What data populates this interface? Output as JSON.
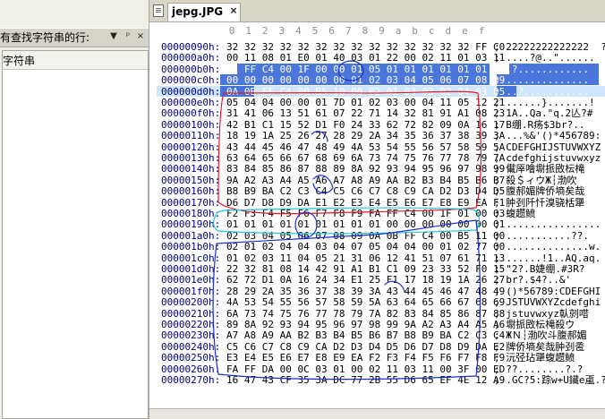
{
  "left_panel": {
    "title": "有查找字符串的行:",
    "pin_button": "▼",
    "dock_button": "ᵖ",
    "close_button": "×",
    "list_item": "字符串"
  },
  "tab": {
    "label": "jepg.JPG",
    "close_label": "×"
  },
  "hex": {
    "column_labels": [
      "0",
      "1",
      "2",
      "3",
      "4",
      "5",
      "6",
      "7",
      "8",
      "9",
      "a",
      "b",
      "c",
      "d",
      "e",
      "f"
    ],
    "rows": [
      {
        "addr": "00000090h:",
        "bytes": "32 32 32 32 32 32 32 32 32 32 32 32 32 32 FF C0",
        "ascii": "; 22222222222222  ?"
      },
      {
        "addr": "000000a0h:",
        "bytes": "00 11 08 01 E0 01 40 03 01 22 00 02 11 01 03 11",
        "ascii": "; ....?@..\"......"
      },
      {
        "addr": "000000b0h:",
        "bytes": "01 FF C4 00 1F 00 00 01 05 01 01 01 01 01 01 00",
        "ascii": "; .?............"
      },
      {
        "addr": "000000c0h:",
        "bytes": "00 00 00 00 00 00 00 01 02 03 04 05 06 07 08 09",
        "ascii": "; .............."
      },
      {
        "addr": "000000d0h:",
        "bytes": "0A 0B FF C4 00 B5 10 00 02 01 03 03 02 04 03 05",
        "ascii": "; ..?..........."
      },
      {
        "addr": "000000e0h:",
        "bytes": "05 04 04 00 00 01 7D 01 02 03 00 04 11 05 12 21",
        "ascii": "; ......}.......!"
      },
      {
        "addr": "000000f0h:",
        "bytes": "31 41 06 13 51 61 07 22 71 14 32 81 91 A1 08 23",
        "ascii": "; 1A..Qa.\"q.2亾?#"
      },
      {
        "addr": "00000100h:",
        "bytes": "42 B1 C1 15 52 D1 F0 24 33 62 72 82 09 0A 16 17",
        "ascii": "; B绷.R疡$3br?.."
      },
      {
        "addr": "00000110h:",
        "bytes": "18 19 1A 25 26 27 28 29 2A 34 35 36 37 38 39 3A",
        "ascii": "; ...%&'()*456789:"
      },
      {
        "addr": "00000120h:",
        "bytes": "43 44 45 46 47 48 49 4A 53 54 55 56 57 58 59 5A",
        "ascii": "; CDEFGHIJSTUVWXYZ"
      },
      {
        "addr": "00000130h:",
        "bytes": "63 64 65 66 67 68 69 6A 73 74 75 76 77 78 79 7A",
        "ascii": "; cdefghijstuvwxyz"
      },
      {
        "addr": "00000140h:",
        "bytes": "83 84 85 86 87 88 89 8A 92 93 94 95 96 97 98 99",
        "ascii": "; 儎厗噲墛挀敃枟槞"
      },
      {
        "addr": "00000150h:",
        "bytes": "9A A2 A3 A4 A5 A6 A7 A8 A9 AA B2 B3 B4 B5 B6 B7",
        "ascii": "; 殺＄ィウЖ┆渤吹"
      },
      {
        "addr": "00000160h:",
        "bytes": "B8 B9 BA C2 C3 C4 C5 C6 C7 C8 C9 CA D2 D3 D4 D5",
        "ascii": "; 腹郝媚牌侨墒矣哉"
      },
      {
        "addr": "00000170h:",
        "bytes": "D6 D7 D8 D9 DA E1 E2 E3 E4 E5 E6 E7 E8 E9 EA F1",
        "ascii": "; 肿刭阡忏溴骁栝犟"
      },
      {
        "addr": "00000180h:",
        "bytes": "F2 F3 F4 F5 F6 F7 F8 F9 FA FF C4 00 1F 01 00 03",
        "ascii": "; 蝮趱鲼"
      },
      {
        "addr": "00000190h:",
        "bytes": "01 01 01 01 01 01 01 01 01 00 00 00 00 00 00 01",
        "ascii": "; ................"
      },
      {
        "addr": "000001a0h:",
        "bytes": "02 03 04 05 06 07 08 09 0A 0B FF C4 00 B5 11 00",
        "ascii": "; ...........??."
      },
      {
        "addr": "000001b0h:",
        "bytes": "02 01 02 04 04 03 04 07 05 04 04 00 01 02 77 00",
        "ascii": "; ..............w."
      },
      {
        "addr": "000001c0h:",
        "bytes": "01 02 03 11 04 05 21 31 06 12 41 51 07 61 71 13",
        "ascii": "; ......!1..AQ.aq."
      },
      {
        "addr": "000001d0h:",
        "bytes": "22 32 81 08 14 42 91 A1 B1 C1 09 23 33 52 F0 15",
        "ascii": "; \"2?.B婕绷.#3R?"
      },
      {
        "addr": "000001e0h:",
        "bytes": "62 72 D1 0A 16 24 34 E1 25 F1 17 18 19 1A 26 27",
        "ascii": "; br?.$4?..&'"
      },
      {
        "addr": "000001f0h:",
        "bytes": "28 29 2A 35 36 37 38 39 3A 43 44 45 46 47 48 49",
        "ascii": "; ()*56789:CDEFGHI"
      },
      {
        "addr": "00000200h:",
        "bytes": "4A 53 54 55 56 57 58 59 5A 63 64 65 66 67 68 69",
        "ascii": "; JSTUVWXYZcdefghi"
      },
      {
        "addr": "00000210h:",
        "bytes": "6A 73 74 75 76 77 78 79 7A 82 83 84 85 86 87 88",
        "ascii": "; jstuvwxyz倝剠唶"
      },
      {
        "addr": "00000220h:",
        "bytes": "89 8A 92 93 94 95 96 97 98 99 9A A2 A3 A4 A5 A6",
        "ascii": "; 墛挀敃枟槞殺ウ"
      },
      {
        "addr": "00000230h:",
        "bytes": "A7 A8 A9 AA B2 B3 B4 B5 B6 B7 B8 B9 BA C2 C3 C4",
        "ascii": "; ЖＮ┆渤吹斗腹郝媚"
      },
      {
        "addr": "00000240h:",
        "bytes": "C5 C6 C7 C8 C9 CA D2 D3 D4 D5 D6 D7 D8 D9 DA E2",
        "ascii": "; 牌侨墒矣哉肿刭卺"
      },
      {
        "addr": "00000250h:",
        "bytes": "E3 E4 E5 E6 E7 E8 E9 EA F2 F3 F4 F5 F6 F7 F8 F9",
        "ascii": "; 沅弪玷犟蝮趱鲼"
      },
      {
        "addr": "00000260h:",
        "bytes": "FA FF DA 00 0C 03 01 00 02 11 03 11 00 3F 00 ED",
        "ascii": "; ??........?.?"
      },
      {
        "addr": "00000270h:",
        "bytes": "16 47 43 CF 35 3A DC 77 2B 55 D6 65 EF 4E 12 A9",
        "ascii": "; .GC?5:踪w+U鑶e颪.?"
      }
    ]
  },
  "colors": {
    "selection": "#2c5fd6",
    "row_highlight": "#cfe6fb",
    "address": "#000080",
    "red_mark": "#e11d2b",
    "cyan_mark": "#24c7d6",
    "blue_mark": "#1a2fd0"
  }
}
